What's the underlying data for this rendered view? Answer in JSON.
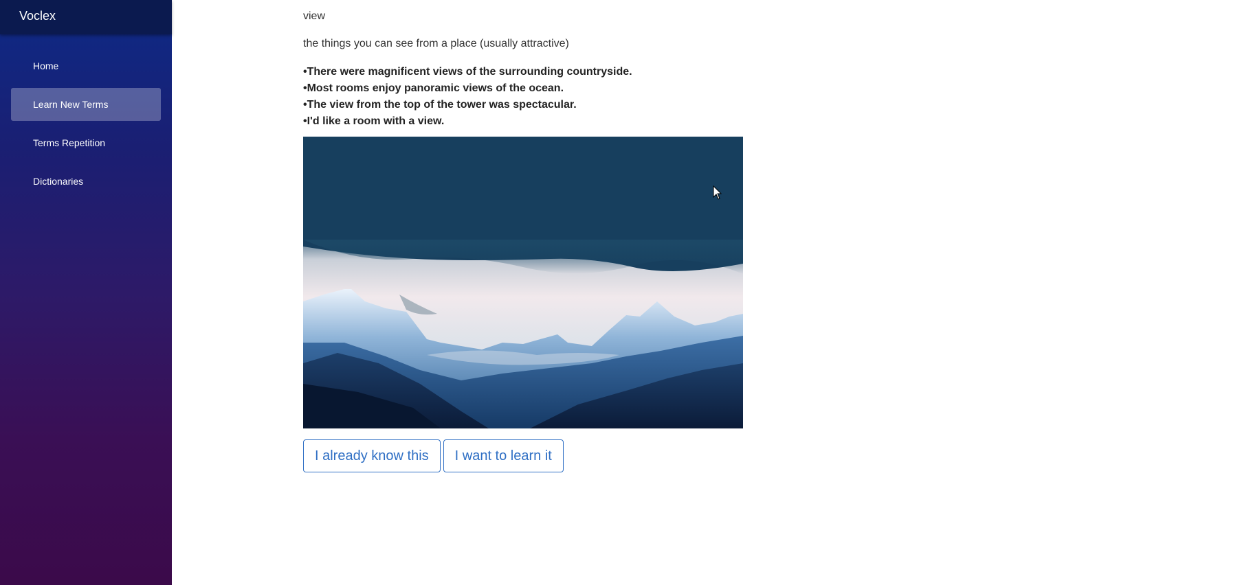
{
  "app": {
    "title": "Voclex"
  },
  "sidebar": {
    "items": [
      {
        "label": "Home",
        "active": false
      },
      {
        "label": "Learn New Terms",
        "active": true
      },
      {
        "label": "Terms Repetition",
        "active": false
      },
      {
        "label": "Dictionaries",
        "active": false
      }
    ]
  },
  "card": {
    "term": "view",
    "definition": "the things you can see from a place (usually attractive)",
    "examples": [
      "•There were magnificent views of the surrounding countryside.",
      "•Most rooms enjoy panoramic views of the ocean.",
      "•The view from the top of the tower was spectacular.",
      "•I'd like a room with a view."
    ],
    "image": {
      "subject": "mountain-landscape"
    }
  },
  "actions": {
    "know_label": "I already know this",
    "learn_label": "I want to learn it"
  },
  "colors": {
    "accent": "#2f6fc4",
    "sidebar_top": "#0d2a86",
    "sidebar_bottom": "#3b0a4a"
  }
}
